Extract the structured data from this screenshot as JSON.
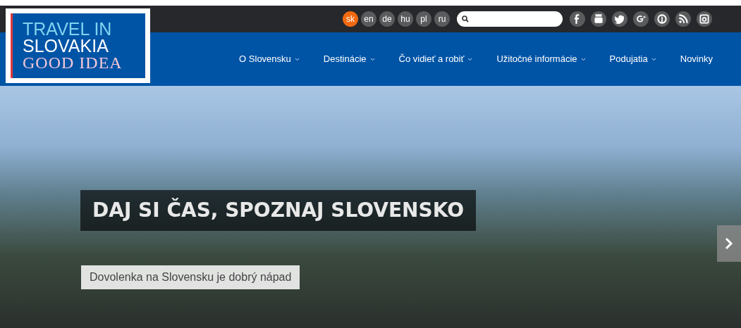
{
  "logo": {
    "lines": [
      "TRAVEL IN",
      "SLOVAKIA",
      "GOOD IDEA"
    ]
  },
  "languages": [
    {
      "code": "sk",
      "selected": true
    },
    {
      "code": "en",
      "selected": false
    },
    {
      "code": "de",
      "selected": false
    },
    {
      "code": "hu",
      "selected": false
    },
    {
      "code": "pl",
      "selected": false
    },
    {
      "code": "ru",
      "selected": false
    }
  ],
  "nav": [
    {
      "label": "O Slovensku",
      "dropdown": true
    },
    {
      "label": "Destinácie",
      "dropdown": true
    },
    {
      "label": "Čo vidieť a robiť",
      "dropdown": true
    },
    {
      "label": "Užitočné informácie",
      "dropdown": true
    },
    {
      "label": "Podujatia",
      "dropdown": true
    },
    {
      "label": "Novinky",
      "dropdown": false
    }
  ],
  "hero": {
    "title": "DAJ SI ČAS, SPOZNAJ SLOVENSKO",
    "subtitle": "Dovolenka na Slovensku je dobrý nápad"
  }
}
